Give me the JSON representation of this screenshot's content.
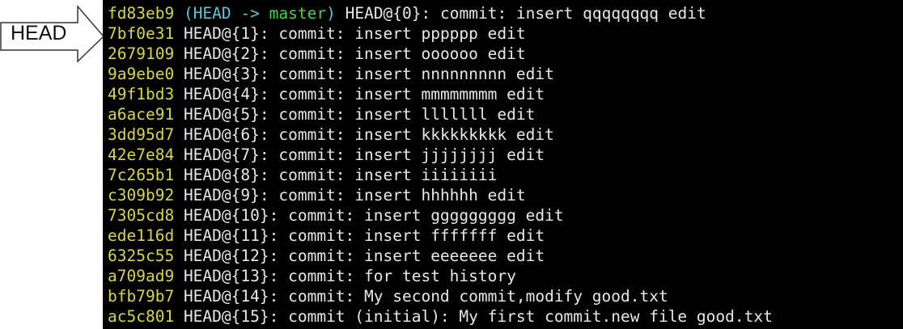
{
  "callout": {
    "label": "HEAD"
  },
  "reflog": [
    {
      "hash": "fd83eb9",
      "head_decoration": true,
      "paren_open": "(",
      "head": "HEAD",
      "arrow": "->",
      "branch": "master",
      "paren_close": ")",
      "ref": "HEAD@{0}:",
      "message": "commit: insert qqqqqqqq edit"
    },
    {
      "hash": "7bf0e31",
      "ref": "HEAD@{1}:",
      "message": "commit: insert pppppp edit"
    },
    {
      "hash": "2679109",
      "ref": "HEAD@{2}:",
      "message": "commit: insert oooooo edit"
    },
    {
      "hash": "9a9ebe0",
      "ref": "HEAD@{3}:",
      "message": "commit: insert nnnnnnnnn edit"
    },
    {
      "hash": "49f1bd3",
      "ref": "HEAD@{4}:",
      "message": "commit: insert mmmmmmmm edit"
    },
    {
      "hash": "a6ace91",
      "ref": "HEAD@{5}:",
      "message": "commit: insert lllllll edit"
    },
    {
      "hash": "3dd95d7",
      "ref": "HEAD@{6}:",
      "message": "commit: insert kkkkkkkkk edit"
    },
    {
      "hash": "42e7e84",
      "ref": "HEAD@{7}:",
      "message": "commit: insert jjjjjjjj edit"
    },
    {
      "hash": "7c265b1",
      "ref": "HEAD@{8}:",
      "message": "commit: insert iiiiiiii"
    },
    {
      "hash": "c309b92",
      "ref": "HEAD@{9}:",
      "message": "commit: insert hhhhhh edit"
    },
    {
      "hash": "7305cd8",
      "ref": "HEAD@{10}:",
      "message": "commit: insert ggggggggg edit"
    },
    {
      "hash": "ede116d",
      "ref": "HEAD@{11}:",
      "message": "commit: insert fffffff edit"
    },
    {
      "hash": "6325c55",
      "ref": "HEAD@{12}:",
      "message": "commit: insert eeeeeee edit"
    },
    {
      "hash": "a709ad9",
      "ref": "HEAD@{13}:",
      "message": "commit: for test history"
    },
    {
      "hash": "bfb79b7",
      "ref": "HEAD@{14}:",
      "message": "commit: My second commit,modify good.txt"
    },
    {
      "hash": "ac5c801",
      "ref": "HEAD@{15}:",
      "message": "commit (initial): My first commit.new file good.txt"
    }
  ]
}
